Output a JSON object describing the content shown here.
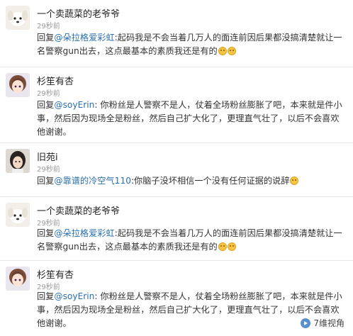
{
  "comments": [
    {
      "username": "一个卖蔬菜的老爷爷",
      "time": "29秒前",
      "prefix": "回复",
      "mention": "@朵拉格爱彩虹",
      "body": ":起码我是不会当着几万人的面连前因后果都没搞清楚就让一名警察gun出去，这点最基本的素质我还是有的",
      "emojis": [
        "smirk-emoji",
        "smirk-emoji"
      ],
      "avatar": "dog-avatar"
    },
    {
      "username": "杉笙有杏",
      "time": "29秒前",
      "prefix": "回复",
      "mention": "@soyErin",
      "body": ": 你粉丝是人警察不是人，仗着全场粉丝膨胀了吧，本来就是件小事，然后因为现场全是粉丝，然后自己扩大化了，更理直气壮了，以后不会喜欢他谢谢。",
      "emojis": [],
      "avatar": "anime-girl-avatar"
    },
    {
      "username": "旧苑i",
      "time": "29秒前",
      "prefix": "回复",
      "mention": "@靠谱的冷空气110",
      "body": ":你脑子没坏相信一个没有任何证据的说辞",
      "emojis": [
        "smile-emoji"
      ],
      "avatar": "girl-avatar"
    },
    {
      "username": "一个卖蔬菜的老爷爷",
      "time": "29秒前",
      "prefix": "回复",
      "mention": "@朵拉格爱彩虹",
      "body": ":起码我是不会当着几万人的面连前因后果都没搞清楚就让一名警察gun出去，这点最基本的素质我还是有的",
      "emojis": [
        "smirk-emoji",
        "smirk-emoji"
      ],
      "avatar": "dog-avatar"
    },
    {
      "username": "杉笙有杏",
      "time": "29秒前",
      "prefix": "回复",
      "mention": "@soyErin",
      "body": ": 你粉丝是人警察不是人，仗着全场粉丝膨胀了吧，本来就是件小事，然后因为现场全是粉丝，然后自己扩大化了，更理直气壮了，以后不会喜欢他谢谢。",
      "emojis": [],
      "avatar": "anime-girl-avatar"
    }
  ],
  "watermark": {
    "text": "7维视角",
    "icon": "play-icon"
  },
  "colors": {
    "mention": "#2a6fb0",
    "username": "#222222",
    "timestamp": "#999999",
    "divider": "#e6e6e6"
  }
}
